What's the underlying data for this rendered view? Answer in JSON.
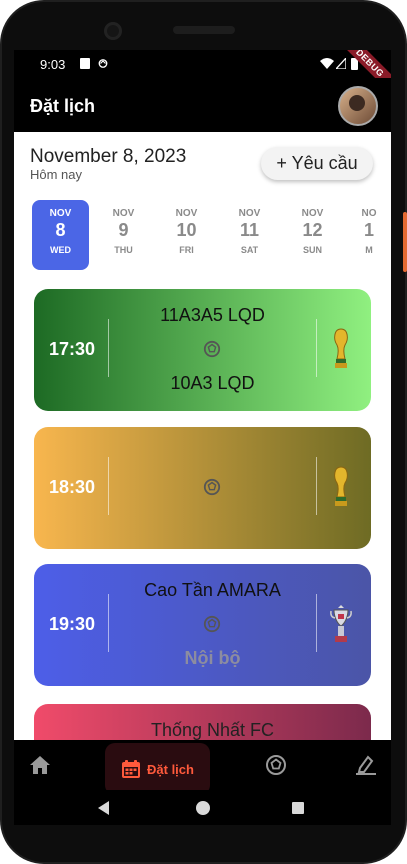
{
  "status_bar": {
    "time": "9:03",
    "debug_label": "DEBUG"
  },
  "app_bar": {
    "title": "Đặt lịch",
    "avatar_icon": "user-avatar"
  },
  "header": {
    "date": "November 8, 2023",
    "subtitle": "Hôm nay",
    "request_button": "+ Yêu cầu"
  },
  "days": [
    {
      "month": "NOV",
      "day": "8",
      "weekday": "WED",
      "active": true
    },
    {
      "month": "NOV",
      "day": "9",
      "weekday": "THU"
    },
    {
      "month": "NOV",
      "day": "10",
      "weekday": "FRI"
    },
    {
      "month": "NOV",
      "day": "11",
      "weekday": "SAT"
    },
    {
      "month": "NOV",
      "day": "12",
      "weekday": "SUN"
    },
    {
      "month": "NO",
      "day": "1",
      "weekday": "M"
    }
  ],
  "matches": [
    {
      "time": "17:30",
      "home": "11A3A5 LQD",
      "away": "10A3 LQD",
      "trophy_icon": "world-cup-trophy-icon"
    },
    {
      "time": "18:30",
      "home": "",
      "away": "",
      "trophy_icon": "world-cup-trophy-icon"
    },
    {
      "time": "19:30",
      "home": "Cao Tần AMARA",
      "away": "Nội bộ",
      "trophy_icon": "fa-cup-trophy-icon"
    },
    {
      "time": "",
      "home": "Thống Nhất FC",
      "away": ""
    }
  ],
  "bottom_nav": {
    "items": [
      {
        "icon": "home-icon"
      },
      {
        "icon": "calendar-icon",
        "label": "Đặt lịch",
        "active": true
      },
      {
        "icon": "soccer-ball-icon"
      },
      {
        "icon": "edit-icon"
      }
    ]
  },
  "colors": {
    "accent": "#4b66e6",
    "nav_active": "#ff5a3c",
    "card1_start": "#1d6a24",
    "card1_end": "#90f080",
    "card2_start": "#f8b64e",
    "card2_end": "#6e6b24",
    "card3_start": "#4d5ee8",
    "card3_end": "#4b55a7",
    "card4_start": "#f04b6a",
    "card4_end": "#7c2a4c"
  }
}
